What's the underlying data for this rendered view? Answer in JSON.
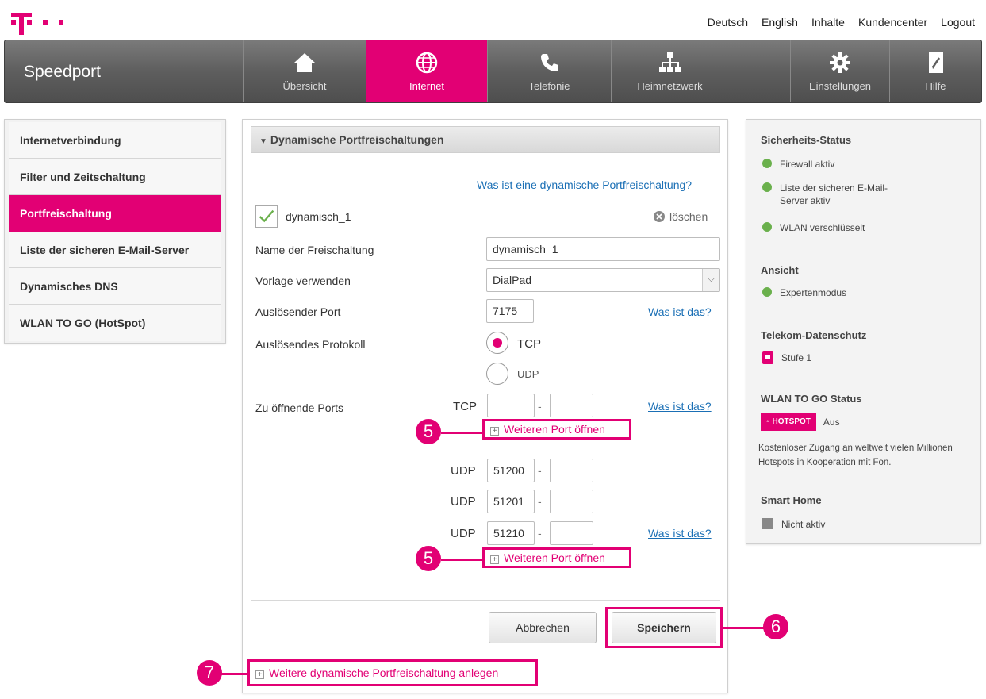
{
  "top_links": [
    "Deutsch",
    "English",
    "Inhalte",
    "Kundencenter",
    "Logout"
  ],
  "brand": "Speedport",
  "nav": [
    {
      "label": "Übersicht",
      "icon": "home-icon"
    },
    {
      "label": "Internet",
      "icon": "globe-icon"
    },
    {
      "label": "Telefonie",
      "icon": "phone-icon"
    },
    {
      "label": "Heimnetzwerk",
      "icon": "network-icon"
    },
    {
      "label": "Einstellungen",
      "icon": "gear-icon"
    },
    {
      "label": "Hilfe",
      "icon": "help-icon"
    }
  ],
  "sidebar": [
    "Internetverbindung",
    "Filter und Zeitschaltung",
    "Portfreischaltung",
    "Liste der sicheren E-Mail-Server",
    "Dynamisches DNS",
    "WLAN TO GO (HotSpot)"
  ],
  "main": {
    "section_title": "Dynamische Portfreischaltungen",
    "help_link": "Was ist eine dynamische Portfreischaltung?",
    "entry_name": "dynamisch_1",
    "delete_label": "löschen",
    "name_label": "Name der Freischaltung",
    "name_value": "dynamisch_1",
    "template_label": "Vorlage verwenden",
    "template_value": "DialPad",
    "trigger_port_label": "Auslösender Port",
    "trigger_port_value": "7175",
    "what_is_link": "Was ist das?",
    "trigger_protocol_label": "Auslösendes Protokoll",
    "protocol_tcp": "TCP",
    "protocol_udp": "UDP",
    "ports_label": "Zu öffnende Ports",
    "tcp_label": "TCP",
    "udp_label": "UDP",
    "udp_ports": [
      "51200",
      "51201",
      "51210"
    ],
    "add_port_link": "Weiteren Port öffnen",
    "cancel_label": "Abbrechen",
    "save_label": "Speichern",
    "add_rule_link": "Weitere dynamische Portfreischaltung anlegen",
    "dash": "-",
    "plus": "+",
    "callouts": [
      "5",
      "5",
      "6",
      "7"
    ]
  },
  "info": {
    "security_title": "Sicherheits-Status",
    "security_items": [
      "Firewall aktiv",
      "Liste der sicheren E-Mail-Server aktiv",
      "WLAN verschlüsselt"
    ],
    "view_title": "Ansicht",
    "view_item": "Expertenmodus",
    "privacy_title": "Telekom-Datenschutz",
    "privacy_item": "Stufe 1",
    "wlan_title": "WLAN TO GO Status",
    "hotspot_badge": "HOTSPOT",
    "hotspot_state": "Aus",
    "wlan_desc": "Kostenloser Zugang an weltweit vielen Millionen Hotspots in Kooperation mit Fon.",
    "smarthome_title": "Smart Home",
    "smarthome_item": "Nicht aktiv"
  },
  "colors": {
    "accent": "#e20074",
    "ok": "#6ab04c",
    "nav": "#5e5e5e"
  }
}
